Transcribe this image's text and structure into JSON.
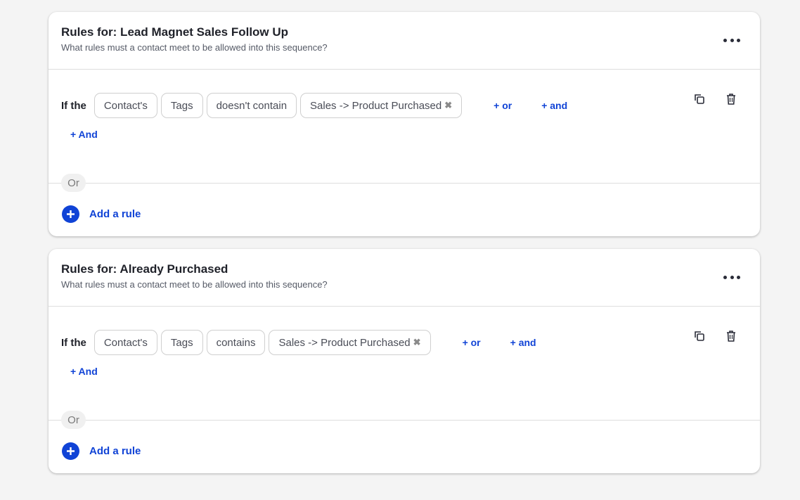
{
  "colors": {
    "accent": "#1043d6",
    "background": "#f4f4f4"
  },
  "cards": [
    {
      "title": "Rules for: Lead Magnet Sales Follow Up",
      "subtitle": "What rules must a contact meet to be allowed into this sequence?",
      "more_icon": "more-horizontal-icon",
      "rule": {
        "if_label": "If the",
        "subject": "Contact's",
        "field": "Tags",
        "operator": "doesn't contain",
        "value": "Sales -> Product Purchased",
        "remove_icon": "✖",
        "or_label": "+ or",
        "and_label": "+ and"
      },
      "and_group_label": "+ And",
      "or_badge": "Or",
      "add_rule_label": "Add a rule"
    },
    {
      "title": "Rules for: Already Purchased",
      "subtitle": "What rules must a contact meet to be allowed into this sequence?",
      "more_icon": "more-horizontal-icon",
      "rule": {
        "if_label": "If the",
        "subject": "Contact's",
        "field": "Tags",
        "operator": "contains",
        "value": "Sales -> Product Purchased",
        "remove_icon": "✖",
        "or_label": "+ or",
        "and_label": "+ and"
      },
      "and_group_label": "+ And",
      "or_badge": "Or",
      "add_rule_label": "Add a rule"
    }
  ]
}
